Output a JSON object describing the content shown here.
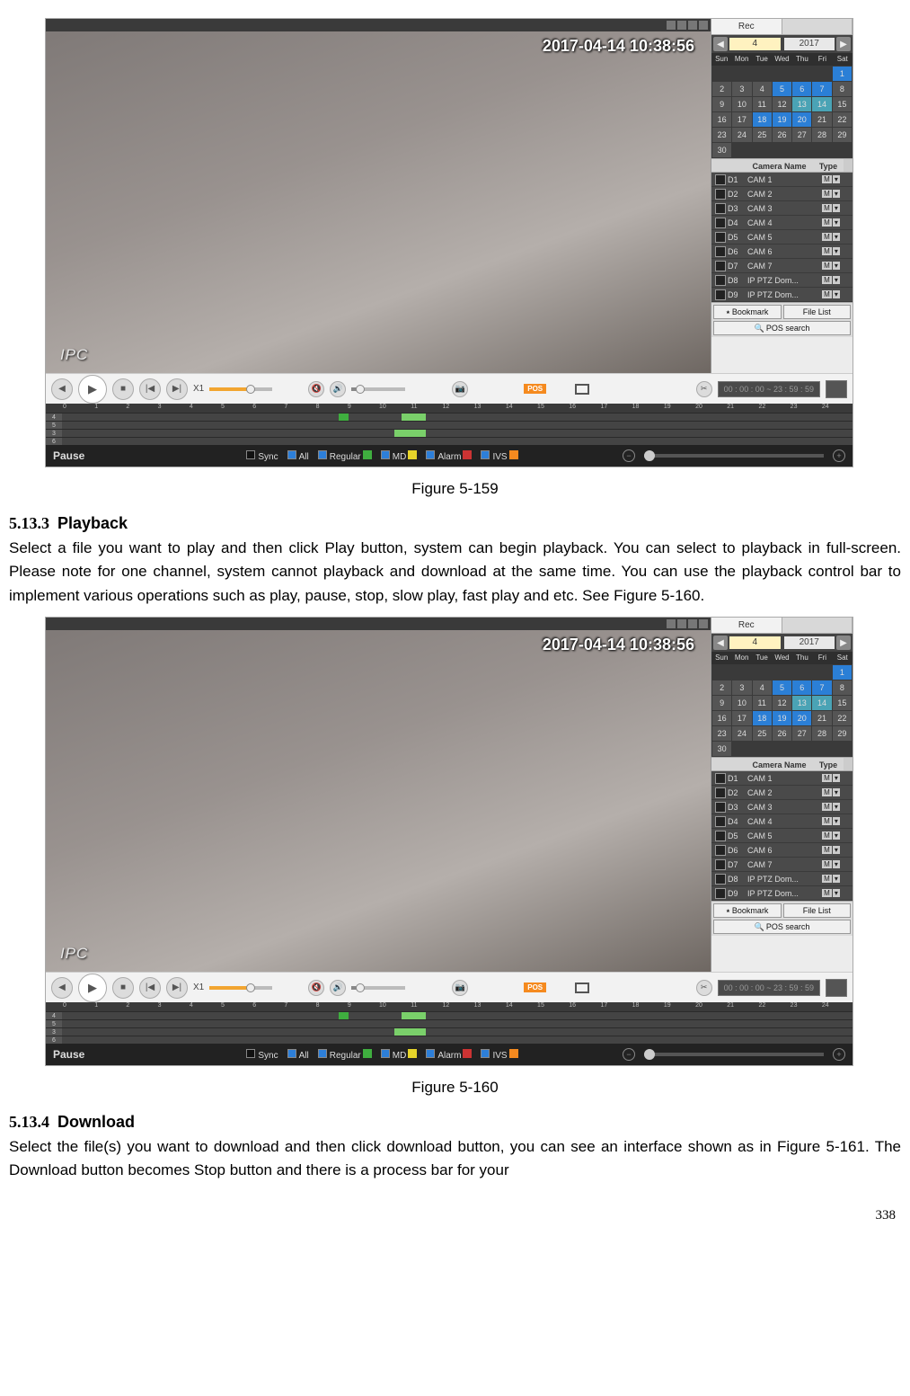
{
  "figure1_caption": "Figure 5-159",
  "figure2_caption": "Figure 5-160",
  "section_playback_num": "5.13.3",
  "section_playback_name": "Playback",
  "playback_text": "Select a file you want to play and then click Play button, system can begin playback. You can select to playback in full-screen. Please note for one channel, system cannot playback and download at the same time. You can use the playback control bar to implement various operations such as play, pause, stop, slow play, fast play and etc. See Figure 5-160.",
  "section_download_num": "5.13.4",
  "section_download_name": "Download",
  "download_text": "Select the file(s) you want to download and then click download button, you can see an interface shown as in Figure 5-161. The Download button becomes Stop button and there is a process bar for your",
  "page_number": "338",
  "player": {
    "timestamp": "2017-04-14 10:38:56",
    "ipc_label": "IPC",
    "side_tab": "Rec",
    "month": "4",
    "year": "2017",
    "dow": [
      "Sun",
      "Mon",
      "Tue",
      "Wed",
      "Thu",
      "Fri",
      "Sat"
    ],
    "weeks": [
      [
        "",
        "",
        "",
        "",
        "",
        "",
        "1"
      ],
      [
        "2",
        "3",
        "4",
        "5",
        "6",
        "7",
        "8"
      ],
      [
        "9",
        "10",
        "11",
        "12",
        "13",
        "14",
        "15"
      ],
      [
        "16",
        "17",
        "18",
        "19",
        "20",
        "21",
        "22"
      ],
      [
        "23",
        "24",
        "25",
        "26",
        "27",
        "28",
        "29"
      ],
      [
        "30",
        "",
        "",
        "",
        "",
        "",
        ""
      ]
    ],
    "hi1": [
      "1",
      "5",
      "6",
      "7",
      "18",
      "19",
      "20"
    ],
    "hi2": [
      "13",
      "14"
    ],
    "cam_header": {
      "c2": "Camera Name",
      "c3": "Type"
    },
    "cameras": [
      {
        "id": "D1",
        "name": "CAM 1",
        "type": "M"
      },
      {
        "id": "D2",
        "name": "CAM 2",
        "type": "M"
      },
      {
        "id": "D3",
        "name": "CAM 3",
        "type": "M"
      },
      {
        "id": "D4",
        "name": "CAM 4",
        "type": "M"
      },
      {
        "id": "D5",
        "name": "CAM 5",
        "type": "M"
      },
      {
        "id": "D6",
        "name": "CAM 6",
        "type": "M"
      },
      {
        "id": "D7",
        "name": "CAM 7",
        "type": "M"
      },
      {
        "id": "D8",
        "name": "IP PTZ Dom...",
        "type": "M"
      },
      {
        "id": "D9",
        "name": "IP PTZ Dom...",
        "type": "M"
      }
    ],
    "bookmark_btn": "Bookmark",
    "filelist_btn": "File List",
    "pos_search_btn": "POS search",
    "speed": "X1",
    "pos_badge": "POS",
    "time_range": "00 : 00 : 00 ~ 23 : 59 : 59",
    "hours": [
      "0",
      "1",
      "2",
      "3",
      "4",
      "5",
      "6",
      "7",
      "8",
      "9",
      "10",
      "11",
      "12",
      "13",
      "14",
      "15",
      "16",
      "17",
      "18",
      "19",
      "20",
      "21",
      "22",
      "23",
      "24"
    ],
    "timeline_rows": [
      "4",
      "5",
      "3",
      "6"
    ],
    "footer_status": "Pause",
    "footer_opts": {
      "sync": "Sync",
      "all": "All",
      "regular": "Regular",
      "md": "MD",
      "alarm": "Alarm",
      "ivs": "IVS"
    }
  }
}
